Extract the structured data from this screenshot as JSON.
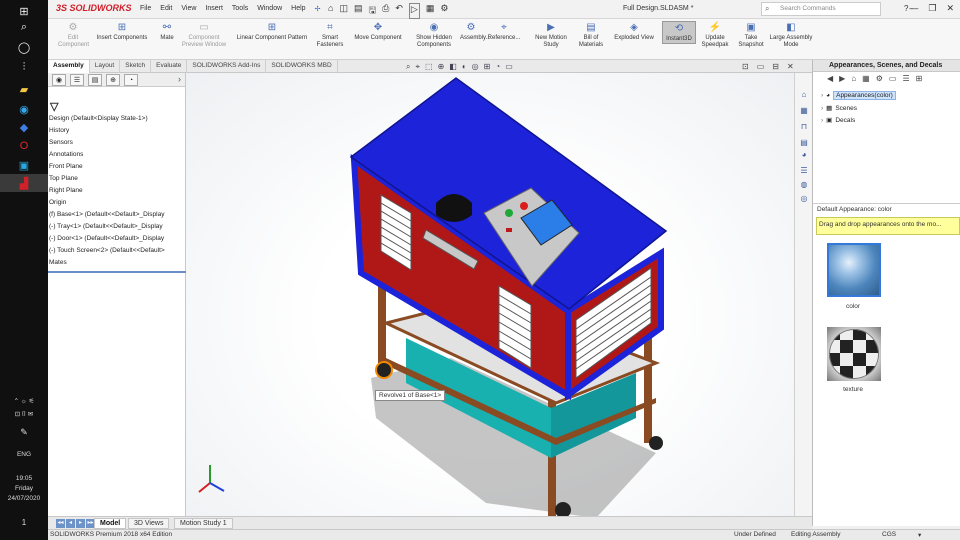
{
  "taskbar": {
    "icons": [
      "windows-icon",
      "search-icon",
      "cortana-icon",
      "task-view-icon",
      "file-explorer-icon",
      "edge-icon",
      "app-icon",
      "opera-icon",
      "app-icon",
      "solidworks-icon"
    ],
    "tray_glyphs": "⌃ ☼ ⚟",
    "tray_glyphs2": "⊡ ⌷ ✉",
    "pen": "✎",
    "language": "ENG",
    "time": "19:05",
    "day": "Friday",
    "date": "24/07/2020",
    "notif": "1"
  },
  "titlebar": {
    "logo": "3S SOLIDWORKS",
    "menus": [
      "File",
      "Edit",
      "View",
      "Insert",
      "Tools",
      "Window",
      "Help"
    ],
    "pin": "✢",
    "quick_access": [
      "⌂",
      "◫",
      "▤",
      "🖫",
      "⎙",
      "↶",
      "▷",
      "▦",
      "⚙"
    ],
    "document_title": "Full Design.SLDASM *",
    "search_placeholder": "Search Commands",
    "help": "? ·",
    "window_controls": [
      "—",
      "❐",
      "✕"
    ]
  },
  "ribbon": {
    "buttons": [
      {
        "label": "Edit Component",
        "icon": "⚙",
        "dim": true
      },
      {
        "label": "Insert Components",
        "icon": "⊞",
        "dim": false
      },
      {
        "label": "Mate",
        "icon": "⚯",
        "dim": false
      },
      {
        "label": "Component Preview Window",
        "icon": "▭",
        "dim": true
      },
      {
        "label": "Linear Component Pattern",
        "icon": "⊞",
        "dim": false
      },
      {
        "label": "Smart Fasteners",
        "icon": "⌗",
        "dim": false
      },
      {
        "label": "Move Component",
        "icon": "✥",
        "dim": false
      },
      {
        "label": "Show Hidden Components",
        "icon": "◉",
        "dim": false
      },
      {
        "label": "Assembly...",
        "icon": "⚙",
        "dim": false
      },
      {
        "label": "Reference...",
        "icon": "⌖",
        "dim": false
      },
      {
        "label": "New Motion Study",
        "icon": "▶",
        "dim": false
      },
      {
        "label": "Bill of Materials",
        "icon": "▤",
        "dim": false
      },
      {
        "label": "Exploded View",
        "icon": "◈",
        "dim": false
      },
      {
        "label": "Instant3D",
        "icon": "⟲",
        "active": true
      },
      {
        "label": "Update Speedpak",
        "icon": "⚡",
        "dim": false
      },
      {
        "label": "Take Snapshot",
        "icon": "▣",
        "dim": false
      },
      {
        "label": "Large Assembly Mode",
        "icon": "◧",
        "dim": false
      }
    ]
  },
  "command_tabs": [
    "Assembly",
    "Layout",
    "Sketch",
    "Evaluate",
    "SOLIDWORKS Add-Ins",
    "SOLIDWORKS MBD"
  ],
  "heads_up": [
    "⌕",
    "⌖",
    "⬚",
    "⊕",
    "◧",
    "◐",
    "◎",
    "⊞",
    "◔",
    "▭"
  ],
  "viewport_controls": [
    "⊡",
    "▭",
    "⊟",
    "✕"
  ],
  "tree": {
    "tabs": [
      "◉",
      "☰",
      "▤",
      "⊕",
      "◔"
    ],
    "collapse": "›",
    "filter_icon": "▽",
    "nodes": [
      "Design (Default<Display State-1>)",
      "History",
      "Sensors",
      "Annotations",
      "Front Plane",
      "Top Plane",
      "Right Plane",
      "Origin",
      "(f) Base<1> (Default<<Default>_Display",
      "(-) Tray<1> (Default<<Default>_Display",
      "(-) Door<1> (Default<<Default>_Display",
      "(-) Touch Screen<2> (Default<<Default>",
      "Mates"
    ]
  },
  "task_icons": [
    "⌂",
    "▦",
    "⊓",
    "▤",
    "◕",
    "☰",
    "◍",
    "◎"
  ],
  "taskpane": {
    "title": "Appearances, Scenes, and Decals",
    "tools": [
      "◀",
      "▶",
      "⌂",
      "▦",
      "⚙",
      "▭",
      "☰",
      "⊞"
    ],
    "nodes": [
      {
        "label": "Appearances(color)",
        "icon": "◕",
        "selected": true
      },
      {
        "label": "Scenes",
        "icon": "▦",
        "selected": false
      },
      {
        "label": "Decals",
        "icon": "▣",
        "selected": false
      }
    ],
    "section_label": "Default Appearance: color",
    "hint": "Drag and drop appearances onto the mo...",
    "swatches": [
      {
        "label": "color"
      },
      {
        "label": "texture"
      }
    ]
  },
  "tooltip": "Revolve1 of Base<1>",
  "bottom_tabs": [
    "Model",
    "3D Views",
    "Motion Study 1"
  ],
  "nav_arrows": [
    "◂◂",
    "◂",
    "▸",
    "▸▸"
  ],
  "status": {
    "left": "SOLIDWORKS Premium 2018 x64 Edition",
    "state": "Under Defined",
    "mode": "Editing Assembly",
    "units": "CGS",
    "more": "▾"
  },
  "colors": {
    "body_blue": "#1c23d8",
    "panel_red": "#b01818",
    "frame_brown": "#8a4a22",
    "tray_teal": "#19b0b0",
    "accent": "#d0202a"
  }
}
